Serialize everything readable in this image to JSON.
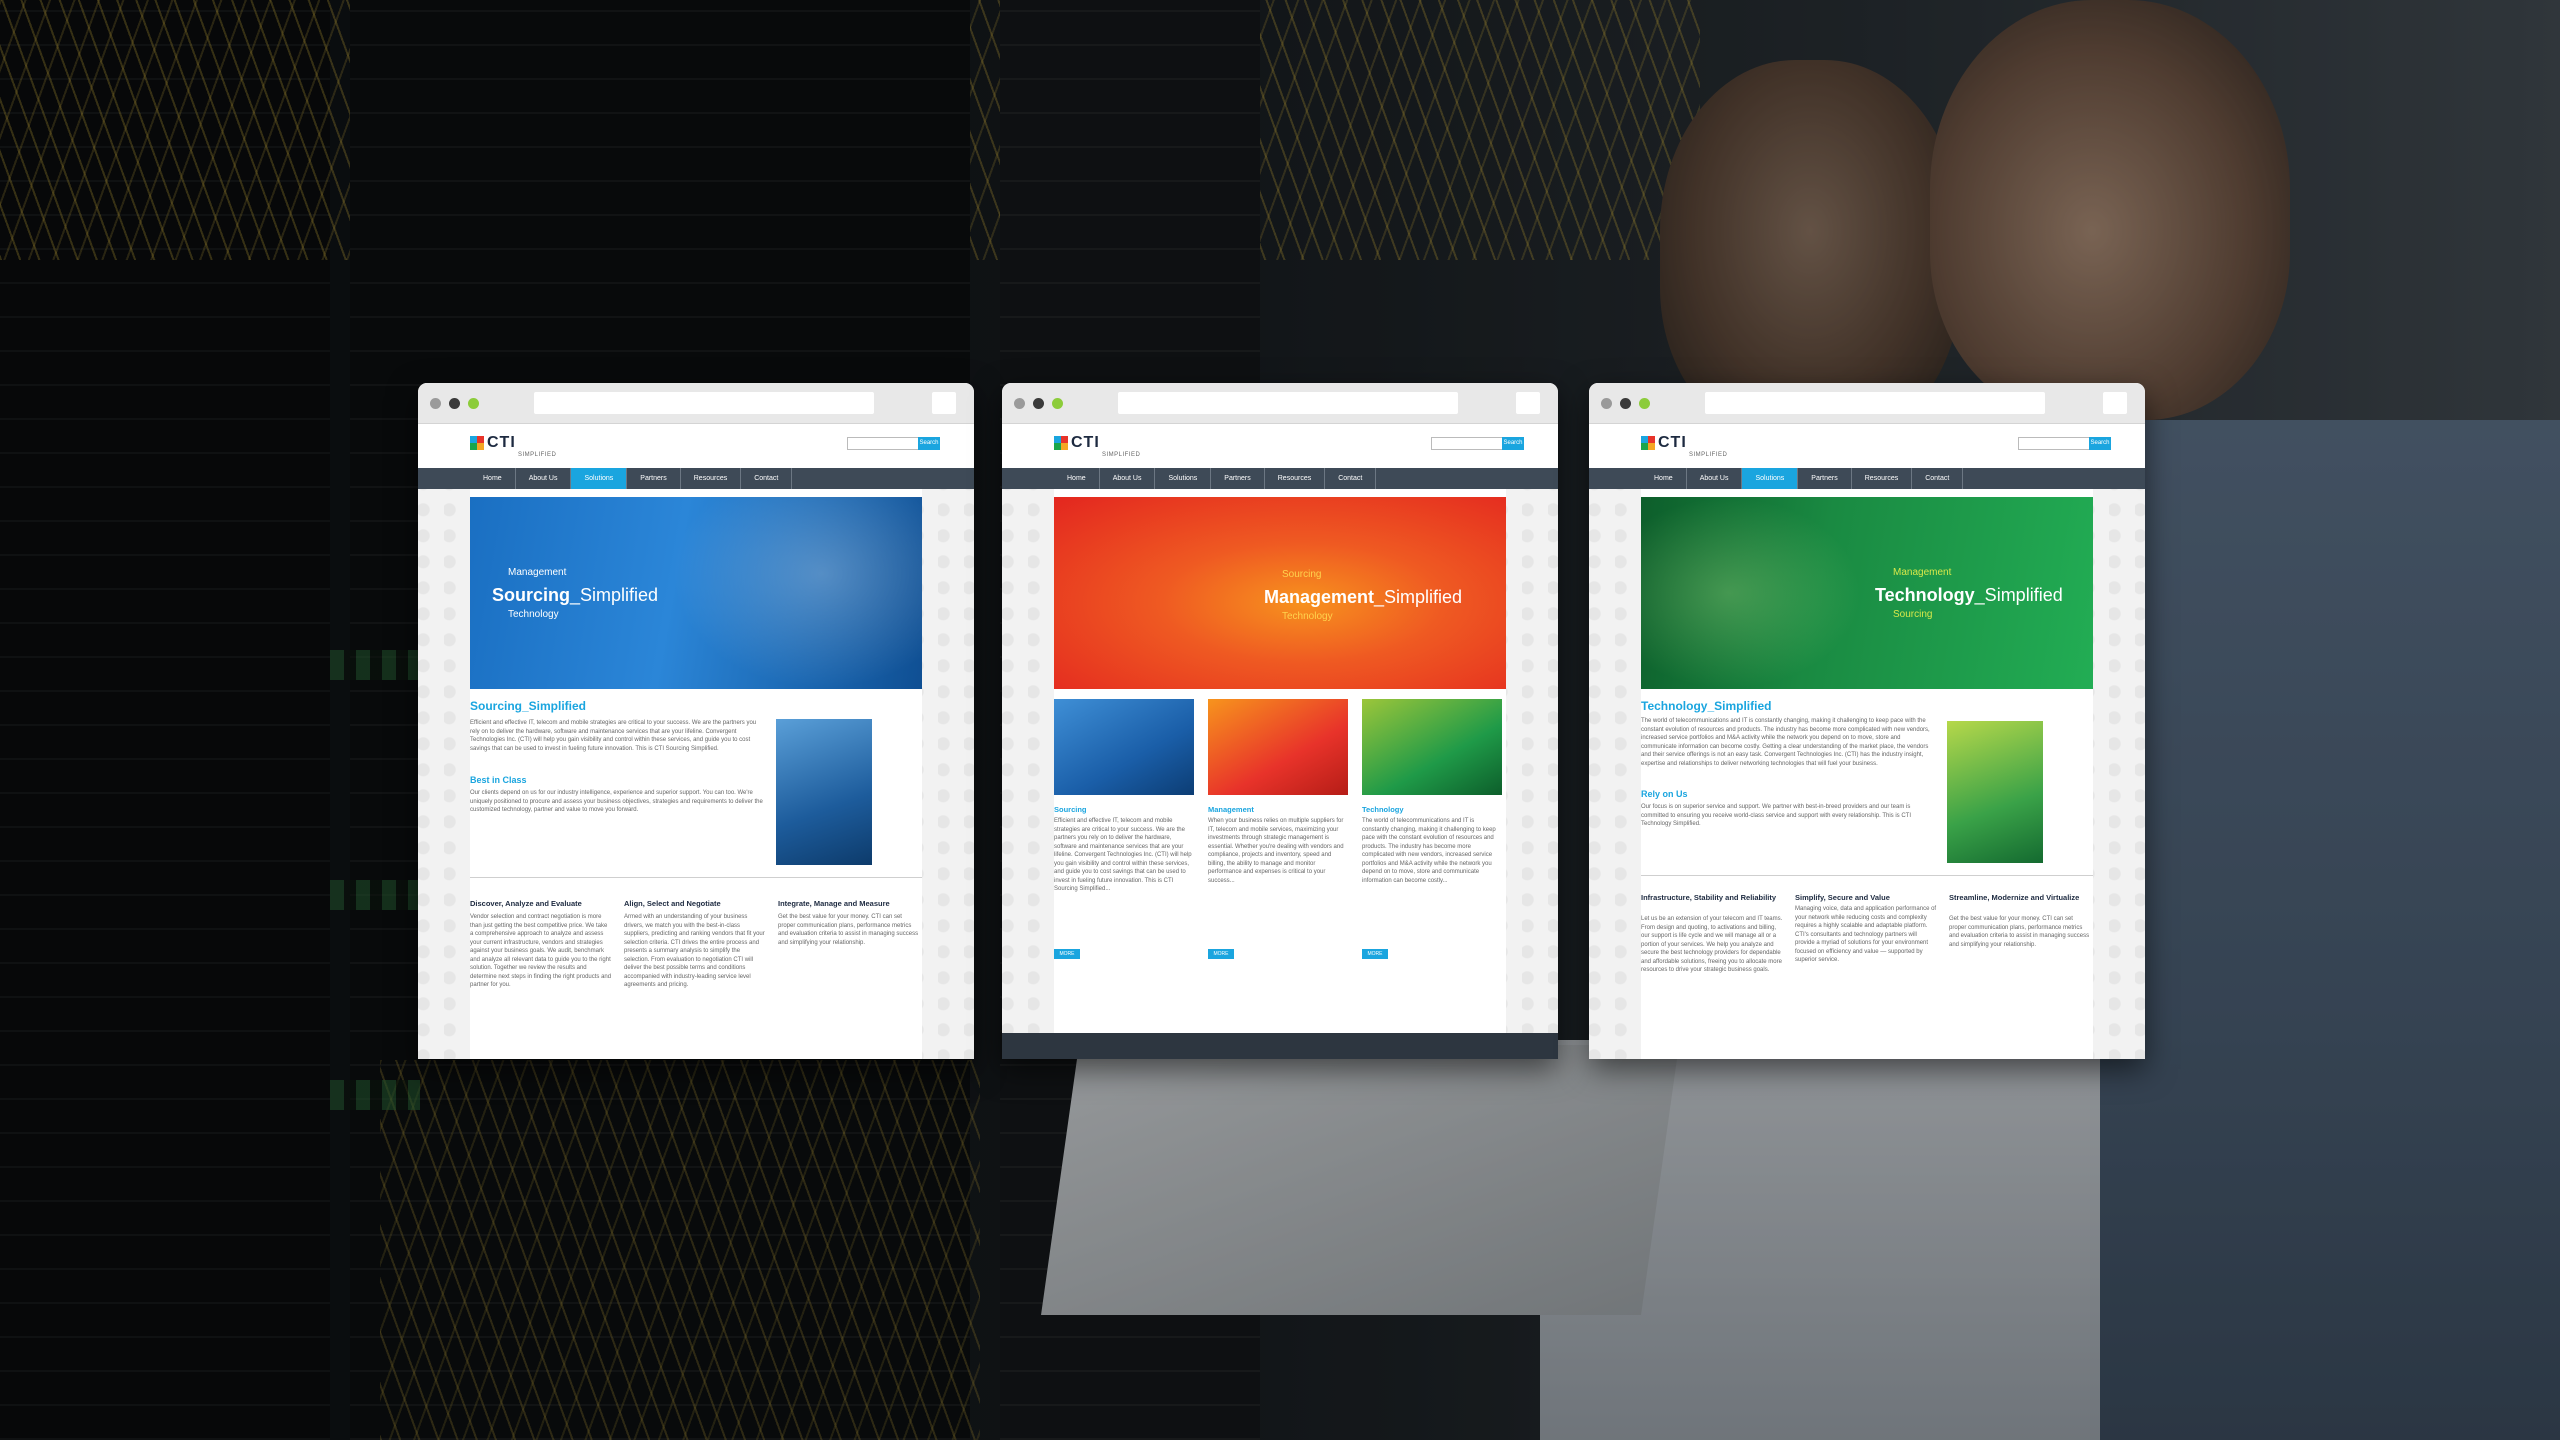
{
  "colors": {
    "accent": "#1aa5df",
    "nav": "#3e4a57",
    "hero_blue": "#1f7fcf",
    "hero_red": "#e8332a",
    "hero_green": "#1aa54a"
  },
  "windows": [
    {
      "logo_text": "CTI",
      "logo_sub": "SIMPLIFIED",
      "search_button": "Search",
      "nav": [
        "Home",
        "About Us",
        "Solutions",
        "Partners",
        "Resources",
        "Contact"
      ],
      "active_nav": "Solutions",
      "hero_top": "Management",
      "hero_big_bold": "Sourcing",
      "hero_big_rest": "_Simplified",
      "hero_bottom": "Technology",
      "section_title": "Sourcing_Simplified",
      "intro": "Efficient and effective IT, telecom and mobile strategies are critical to your success. We are the partners you rely on to deliver the hardware, software and maintenance services that are your lifeline. Convergent Technologies Inc. (CTI) will help you gain visibility and control within these services, and guide you to cost savings that can be used to invest in fueling future innovation. This is CTI Sourcing Simplified.",
      "sub_title": "Best in Class",
      "sub_text": "Our clients depend on us for our industry intelligence, experience and superior support. You can too. We're uniquely positioned to procure and assess your business objectives, strategies and requirements to deliver the customized technology, partner and value to move you forward.",
      "columns": [
        {
          "title": "Discover, Analyze and Evaluate",
          "text": "Vendor selection and contract negotiation is more than just getting the best competitive price. We take a comprehensive approach to analyze and assess your current infrastructure, vendors and strategies against your business goals. We audit, benchmark and analyze all relevant data to guide you to the right solution. Together we review the results and determine next steps in finding the right products and partner for you."
        },
        {
          "title": "Align, Select and Negotiate",
          "text": "Armed with an understanding of your business drivers, we match you with the best-in-class suppliers, predicting and ranking vendors that fit your selection criteria. CTI drives the entire process and presents a summary analysis to simplify the selection. From evaluation to negotiation CTI will deliver the best possible terms and conditions accompanied with industry-leading service level agreements and pricing."
        },
        {
          "title": "Integrate, Manage and Measure",
          "text": "Get the best value for your money. CTI can set proper communication plans, performance metrics and evaluation criteria to assist in managing success and simplifying your relationship."
        }
      ]
    },
    {
      "logo_text": "CTI",
      "logo_sub": "SIMPLIFIED",
      "search_button": "Search",
      "nav": [
        "Home",
        "About Us",
        "Solutions",
        "Partners",
        "Resources",
        "Contact"
      ],
      "active_nav": "",
      "hero_top": "Sourcing",
      "hero_big_bold": "Management",
      "hero_big_rest": "_Simplified",
      "hero_bottom": "Technology",
      "cards": [
        {
          "title": "Sourcing",
          "text": "Efficient and effective IT, telecom and mobile strategies are critical to your success. We are the partners you rely on to deliver the hardware, software and maintenance services that are your lifeline. Convergent Technologies Inc. (CTI) will help you gain visibility and control within these services, and guide you to cost savings that can be used to invest in fueling future innovation. This is CTI Sourcing Simplified...",
          "button": "MORE"
        },
        {
          "title": "Management",
          "text": "When your business relies on multiple suppliers for IT, telecom and mobile services, maximizing your investments through strategic management is essential. Whether you're dealing with vendors and compliance, projects and inventory, speed and billing, the ability to manage and monitor performance and expenses is critical to your success...",
          "button": "MORE"
        },
        {
          "title": "Technology",
          "text": "The world of telecommunications and IT is constantly changing, making it challenging to keep pace with the constant evolution of resources and products. The industry has become more complicated with new vendors, increased service portfolios and M&A activity while the network you depend on to move, store and communicate information can become costly...",
          "button": "MORE"
        }
      ]
    },
    {
      "logo_text": "CTI",
      "logo_sub": "SIMPLIFIED",
      "search_button": "Search",
      "nav": [
        "Home",
        "About Us",
        "Solutions",
        "Partners",
        "Resources",
        "Contact"
      ],
      "active_nav": "Solutions",
      "hero_top": "Management",
      "hero_big_bold": "Technology",
      "hero_big_rest": "_Simplified",
      "hero_bottom": "Sourcing",
      "section_title": "Technology_Simplified",
      "intro": "The world of telecommunications and IT is constantly changing, making it challenging to keep pace with the constant evolution of resources and products. The industry has become more complicated with new vendors, increased service portfolios and M&A activity while the network you depend on to move, store and communicate information can become costly. Getting a clear understanding of the market place, the vendors and their service offerings is not an easy task. Convergent Technologies Inc. (CTI) has the industry insight, expertise and relationships to deliver networking technologies that will fuel your business.",
      "sub_title": "Rely on Us",
      "sub_text": "Our focus is on superior service and support. We partner with best-in-breed providers and our team is committed to ensuring you receive world-class service and support with every relationship. This is CTI Technology Simplified.",
      "columns": [
        {
          "title": "Infrastructure, Stability and Reliability",
          "text": "Let us be an extension of your telecom and IT teams. From design and quoting, to activations and billing, our support is life cycle and we will manage all or a portion of your services. We help you analyze and secure the best technology providers for dependable and affordable solutions, freeing you to allocate more resources to drive your strategic business goals."
        },
        {
          "title": "Simplify, Secure and Value",
          "text": "Managing voice, data and application performance of your network while reducing costs and complexity requires a highly scalable and adaptable platform. CTI's consultants and technology partners will provide a myriad of solutions for your environment focused on efficiency and value — supported by superior service."
        },
        {
          "title": "Streamline, Modernize and Virtualize",
          "text": "Get the best value for your money. CTI can set proper communication plans, performance metrics and evaluation criteria to assist in managing success and simplifying your relationship."
        }
      ]
    }
  ]
}
